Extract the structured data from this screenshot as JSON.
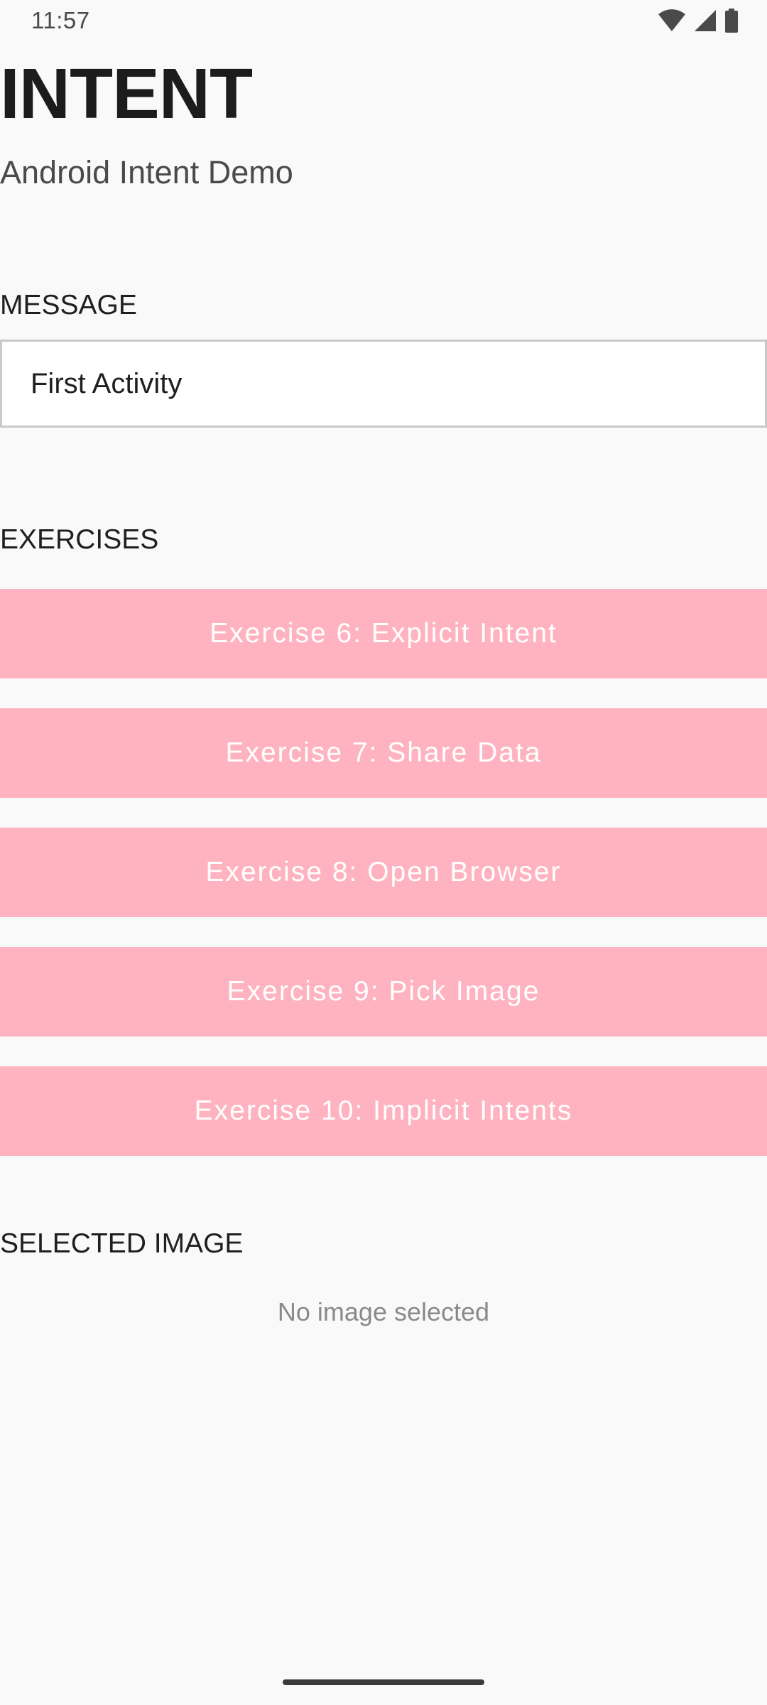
{
  "status_bar": {
    "time": "11:57",
    "icons": [
      "wifi-icon",
      "cellular-signal-icon",
      "battery-icon"
    ]
  },
  "header": {
    "title": "INTENT",
    "subtitle": "Android Intent Demo"
  },
  "message_section": {
    "label": "MESSAGE",
    "input_value": "First Activity"
  },
  "exercises_section": {
    "label": "EXERCISES",
    "buttons": [
      {
        "label": "Exercise 6: Explicit Intent"
      },
      {
        "label": "Exercise 7: Share Data"
      },
      {
        "label": "Exercise 8: Open Browser"
      },
      {
        "label": "Exercise 9: Pick Image"
      },
      {
        "label": "Exercise 10: Implicit Intents"
      }
    ]
  },
  "selected_image_section": {
    "label": "SELECTED IMAGE",
    "placeholder": "No image selected"
  },
  "colors": {
    "background": "#f9f9f9",
    "button_background": "#ffb3c0",
    "button_text": "#ffffff"
  }
}
